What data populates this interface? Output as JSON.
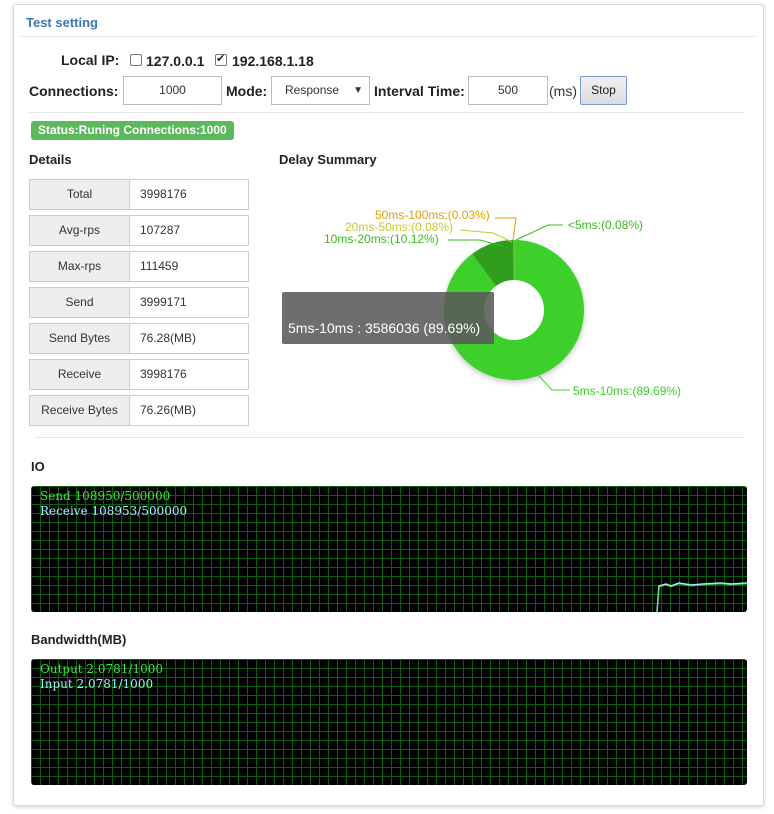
{
  "panel": {
    "title": "Test setting"
  },
  "local_ip": {
    "label": "Local IP:",
    "options": [
      {
        "address": "127.0.0.1",
        "checked": false
      },
      {
        "address": "192.168.1.18",
        "checked": true
      }
    ]
  },
  "controls": {
    "connections_label": "Connections:",
    "connections_value": "1000",
    "mode_label": "Mode:",
    "mode_value": "Response",
    "interval_label": "Interval Time:",
    "interval_value": "500",
    "interval_unit": "(ms)",
    "stop_label": "Stop"
  },
  "status": {
    "text": "Status:Runing Connections:1000",
    "color": "#5cb85c"
  },
  "details": {
    "title": "Details",
    "rows": [
      {
        "key": "Total",
        "value": "3998176"
      },
      {
        "key": "Avg-rps",
        "value": "107287"
      },
      {
        "key": "Max-rps",
        "value": "111459"
      },
      {
        "key": "Send",
        "value": "3999171"
      },
      {
        "key": "Send Bytes",
        "value": "76.28(MB)"
      },
      {
        "key": "Receive",
        "value": "3998176"
      },
      {
        "key": "Receive Bytes",
        "value": "76.26(MB)"
      }
    ]
  },
  "delay_summary": {
    "title": "Delay Summary",
    "tooltip": "5ms-10ms : 3586036 (89.69%)",
    "labels": {
      "lt5": "<5ms:(0.08%)",
      "ms5_10": "5ms-10ms:(89.69%)",
      "ms10_20": "10ms-20ms:(10.12%)",
      "ms20_50": "20ms-50ms:(0.08%)",
      "ms50_100": "50ms-100ms:(0.03%)"
    }
  },
  "chart_data": {
    "type": "pie",
    "title": "Delay Summary",
    "categories": [
      "<5ms",
      "5ms-10ms",
      "10ms-20ms",
      "20ms-50ms",
      "50ms-100ms"
    ],
    "values": [
      0.08,
      89.69,
      10.12,
      0.08,
      0.03
    ],
    "colors": [
      "#3cb91e",
      "#3ecf2a",
      "#2f9e1a",
      "#c8c830",
      "#e0a000"
    ],
    "tooltip_count": 3586036
  },
  "io": {
    "title": "IO",
    "send": "Send 108950/500000",
    "receive": "Receive 108953/500000"
  },
  "bandwidth": {
    "title": "Bandwidth(MB)",
    "output": "Output 2.0781/1000",
    "input": "Input 2.0781/1000"
  },
  "colors": {
    "accent": "#3a7ab8",
    "scope_send": "#3ce83c",
    "scope_receive": "#9ff0ff"
  }
}
